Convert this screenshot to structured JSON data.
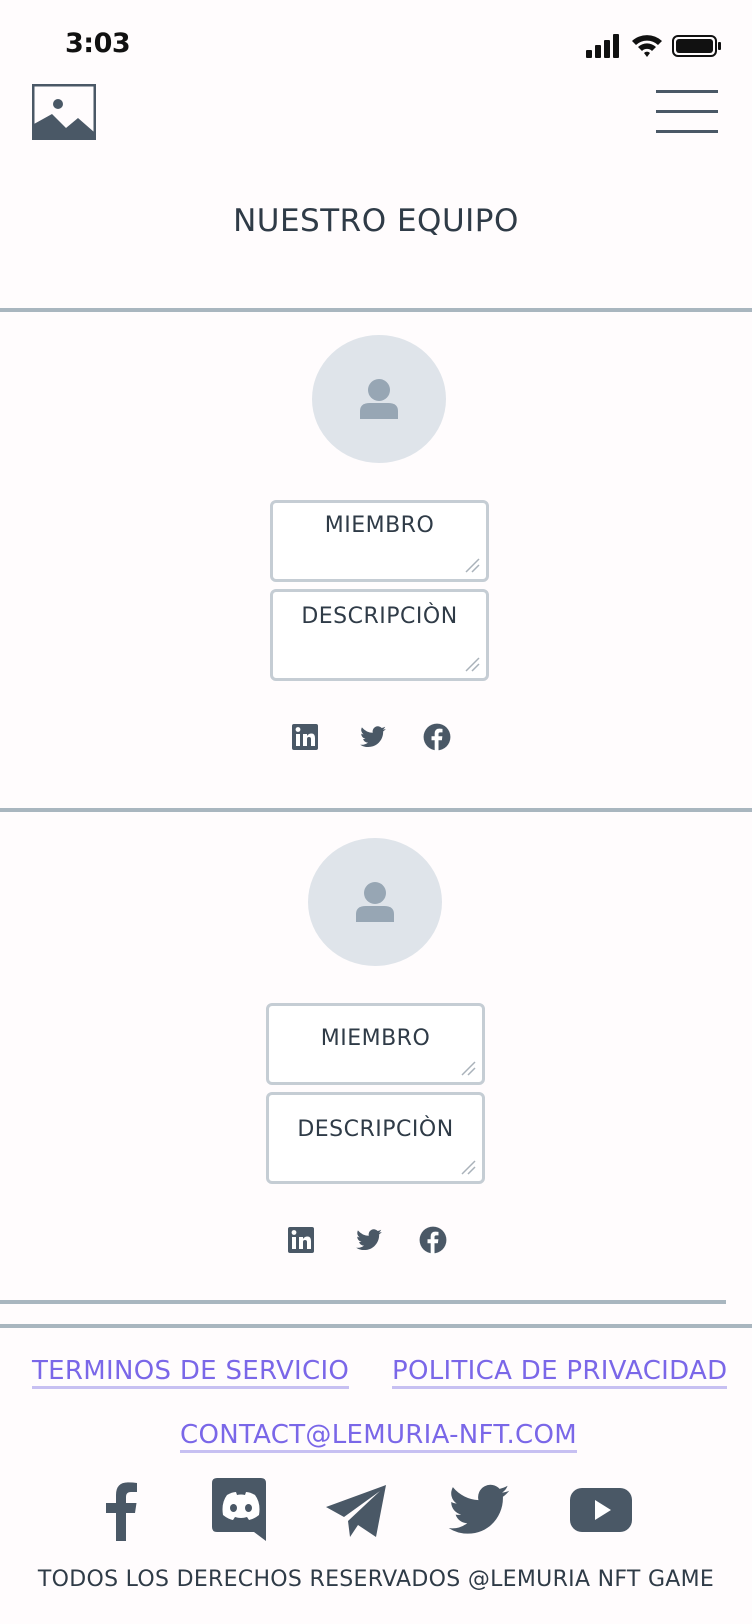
{
  "status_bar": {
    "time": "3:03"
  },
  "header": {
    "logo_icon": "image-placeholder-icon",
    "menu_icon": "hamburger-menu-icon"
  },
  "page": {
    "title": "NUESTRO EQUIPO"
  },
  "team": {
    "members": [
      {
        "name_field": "MIEMBRO",
        "description_field": "DESCRIPCIÒN",
        "social": [
          "linkedin-icon",
          "twitter-icon",
          "facebook-icon"
        ]
      },
      {
        "name_field": "MIEMBRO",
        "description_field": "DESCRIPCIÒN",
        "social": [
          "linkedin-icon",
          "twitter-icon",
          "facebook-icon"
        ]
      }
    ]
  },
  "footer": {
    "terms_label": "TERMINOS DE SERVICIO",
    "privacy_label": "POLITICA DE PRIVACIDAD",
    "contact_email": "CONTACT@LEMURIA-NFT.COM",
    "social_icons": [
      "facebook-icon",
      "discord-icon",
      "telegram-icon",
      "twitter-icon",
      "youtube-icon"
    ],
    "copyright": "TODOS LOS DERECHOS RESERVADOS @LEMURIA NFT GAME"
  },
  "colors": {
    "accent_link": "#7a67e8",
    "icon_dark": "#4a5866",
    "divider": "#a9b6bf",
    "avatar_bg": "#dfe4ea"
  }
}
